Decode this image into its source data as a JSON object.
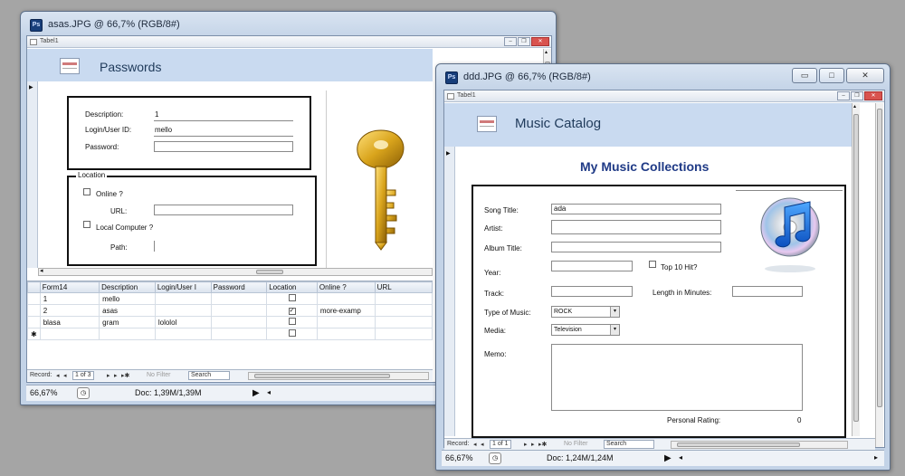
{
  "windows": {
    "passwords": {
      "title": "asas.JPG @ 66,7% (RGB/8#)",
      "doc_tab": "Tabel1",
      "form_title": "Passwords",
      "fields": {
        "description_label": "Description:",
        "description_value": "1",
        "login_label": "Login/User ID:",
        "login_value": "mello",
        "password_label": "Password:"
      },
      "location": {
        "legend": "Location",
        "online_label": "Online ?",
        "url_label": "URL:",
        "local_label": "Local Computer ?",
        "path_label": "Path:"
      },
      "key_image": "golden-key",
      "datasheet": {
        "columns": [
          "Form14",
          "Description",
          "Login/User I",
          "Password",
          "Location",
          "Online ?",
          "URL"
        ],
        "rows": [
          {
            "description": "1",
            "login": "mello",
            "password": "",
            "online": false,
            "url": ""
          },
          {
            "description": "2",
            "login": "asas",
            "password": "",
            "online": true,
            "url": "more-examp"
          },
          {
            "description": "blasa",
            "login": "gram",
            "password": "lololol",
            "online": false,
            "url": ""
          },
          {
            "description": "",
            "login": "",
            "password": "",
            "online": false,
            "url": ""
          }
        ]
      },
      "navbar": {
        "record_label": "Record:",
        "position": "1 of 3",
        "filter_label": "No Filter",
        "search_label": "Search"
      },
      "status": {
        "zoom": "66,67%",
        "doc_size": "Doc: 1,39M/1,39M"
      }
    },
    "music": {
      "title": "ddd.JPG @ 66,7% (RGB/8#)",
      "doc_tab": "Tabel1",
      "form_title": "Music Catalog",
      "heading": "My Music Collections",
      "fields": {
        "song_title_label": "Song Title:",
        "song_title_value": "ada",
        "artist_label": "Artist:",
        "album_title_label": "Album Title:",
        "year_label": "Year:",
        "top10_label": "Top 10 Hit?",
        "track_label": "Track:",
        "length_label": "Length in Minutes:",
        "type_label": "Type of Music:",
        "type_value": "ROCK",
        "media_label": "Media:",
        "media_value": "Television",
        "memo_label": "Memo:",
        "rating_label": "Personal Rating:",
        "rating_value": "0"
      },
      "music_image": "itunes-logo",
      "navbar": {
        "record_label": "Record:",
        "position": "1 of 1",
        "filter_label": "No Filter",
        "search_label": "Search"
      },
      "status": {
        "zoom": "66,67%",
        "doc_size": "Doc: 1,24M/1,24M"
      }
    }
  },
  "colors": {
    "heading_blue": "#1f3a86",
    "form_header": "#c9daf0",
    "desktop": "#a5a5a5"
  }
}
